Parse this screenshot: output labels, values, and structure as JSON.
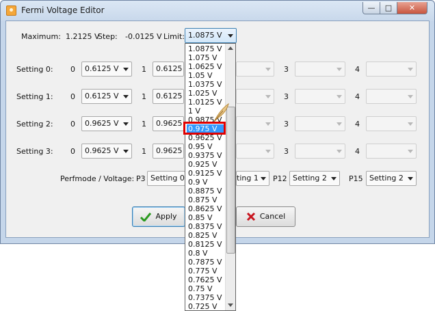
{
  "window": {
    "title": "Fermi Voltage Editor"
  },
  "header": {
    "maximum_label": "Maximum:",
    "maximum_value": "1.2125 V",
    "step_label": "Step:",
    "step_value": "-0.0125 V",
    "limit_label": "Limit:",
    "limit_value": "1.0875 V"
  },
  "settings": [
    {
      "label": "Setting 0:",
      "v0": "0.6125 V",
      "v1": "0.6125 V"
    },
    {
      "label": "Setting 1:",
      "v0": "0.6125 V",
      "v1": "0.6125 V"
    },
    {
      "label": "Setting 2:",
      "v0": "0.9625 V",
      "v1": "0.9625 V"
    },
    {
      "label": "Setting 3:",
      "v0": "0.9625 V",
      "v1": "0.9625 V"
    }
  ],
  "column_indices": [
    "0",
    "1",
    "3",
    "4"
  ],
  "perfmode": {
    "label": "Perfmode / Voltage:",
    "p3_label": "P3",
    "p3_value": "Setting 0",
    "p8_value_partial": "ting 1",
    "p12_label": "P12",
    "p12_value": "Setting 2",
    "p15_label": "P15",
    "p15_value": "Setting 2"
  },
  "buttons": {
    "apply": "Apply",
    "cancel": "Cancel"
  },
  "dropdown": {
    "options": [
      "1.0875 V",
      "1.075 V",
      "1.0625 V",
      "1.05 V",
      "1.0375 V",
      "1.025 V",
      "1.0125 V",
      "1 V",
      "0.9875 V",
      "0.975 V",
      "0.9625 V",
      "0.95 V",
      "0.9375 V",
      "0.925 V",
      "0.9125 V",
      "0.9 V",
      "0.8875 V",
      "0.875 V",
      "0.8625 V",
      "0.85 V",
      "0.8375 V",
      "0.825 V",
      "0.8125 V",
      "0.8 V",
      "0.7875 V",
      "0.775 V",
      "0.7625 V",
      "0.75 V",
      "0.7375 V",
      "0.725 V"
    ],
    "selected_index": 9
  },
  "colors": {
    "selection": "#3399ff",
    "highlight_box": "#e00000"
  },
  "icons": {
    "apply": "check-icon",
    "cancel": "x-icon",
    "cursor": "feather-cursor-icon"
  }
}
